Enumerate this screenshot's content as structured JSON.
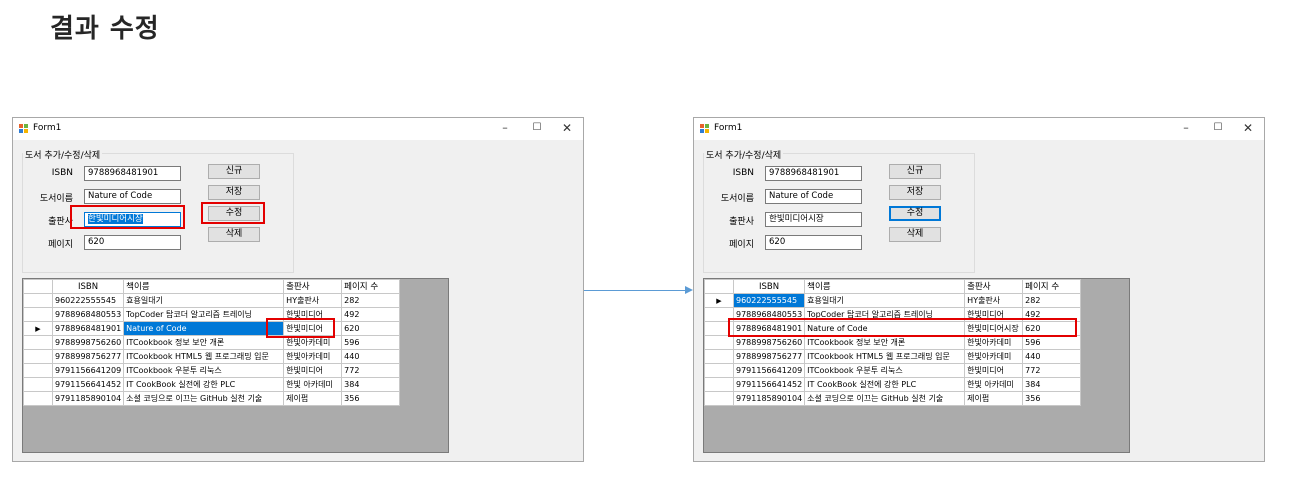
{
  "page_title": "결과 수정",
  "colors": {
    "accent": "#0078d7",
    "highlight": "#e30000",
    "arrow": "#5b9bd5"
  },
  "left_window": {
    "title": "Form1",
    "controls": {
      "minimize": "–",
      "maximize": "☐",
      "close": "✕"
    },
    "group_title": "도서 추가/수정/삭제",
    "labels": {
      "isbn": "ISBN",
      "title": "도서이름",
      "publisher": "출판사",
      "pages": "페이지"
    },
    "fields": {
      "isbn": "9788968481901",
      "title": "Nature of Code",
      "publisher": "한빛미디어시장",
      "pages": "620"
    },
    "buttons": {
      "new": "신규",
      "save": "저장",
      "edit": "수정",
      "delete": "삭제"
    },
    "grid": {
      "columns": [
        "ISBN",
        "책이름",
        "출판사",
        "페이지 수"
      ],
      "current_row_marker": "▶",
      "rows": [
        [
          "960222555545",
          "효용일대기",
          "HY출판사",
          "282"
        ],
        [
          "9788968480553",
          "TopCoder 탑코더 알고리즘 트레이닝",
          "한빛미디어",
          "492"
        ],
        [
          "9788968481901",
          "Nature of Code",
          "한빛미디어",
          "620"
        ],
        [
          "9788998756260",
          "ITCookbook 정보 보안 개론",
          "한빛아카데미",
          "596"
        ],
        [
          "9788998756277",
          "ITCookbook HTML5 웹 프로그래밍 입문",
          "한빛아카데미",
          "440"
        ],
        [
          "9791156641209",
          "ITCookbook 우분투 리눅스",
          "한빛미디어",
          "772"
        ],
        [
          "9791156641452",
          "IT CookBook 실전에 강한 PLC",
          "한빛 아카데미",
          "384"
        ],
        [
          "9791185890104",
          "소셜 코딩으로 이끄는 GitHub 실천 기술",
          "제이펍",
          "356"
        ]
      ]
    }
  },
  "right_window": {
    "title": "Form1",
    "controls": {
      "minimize": "–",
      "maximize": "☐",
      "close": "✕"
    },
    "group_title": "도서 추가/수정/삭제",
    "labels": {
      "isbn": "ISBN",
      "title": "도서이름",
      "publisher": "출판사",
      "pages": "페이지"
    },
    "fields": {
      "isbn": "9788968481901",
      "title": "Nature of Code",
      "publisher": "한빛미디어시장",
      "pages": "620"
    },
    "buttons": {
      "new": "신규",
      "save": "저장",
      "edit": "수정",
      "delete": "삭제"
    },
    "grid": {
      "columns": [
        "ISBN",
        "책이름",
        "출판사",
        "페이지 수"
      ],
      "current_row_marker": "▶",
      "rows": [
        [
          "960222555545",
          "효용일대기",
          "HY출판사",
          "282"
        ],
        [
          "9788968480553",
          "TopCoder 탑코더 알고리즘 트레이닝",
          "한빛미디어",
          "492"
        ],
        [
          "9788968481901",
          "Nature of Code",
          "한빛미디어시장",
          "620"
        ],
        [
          "9788998756260",
          "ITCookbook 정보 보안 개론",
          "한빛아카데미",
          "596"
        ],
        [
          "9788998756277",
          "ITCookbook HTML5 웹 프로그래밍 입문",
          "한빛아카데미",
          "440"
        ],
        [
          "9791156641209",
          "ITCookbook 우분투 리눅스",
          "한빛미디어",
          "772"
        ],
        [
          "9791156641452",
          "IT CookBook 실전에 강한 PLC",
          "한빛 아카데미",
          "384"
        ],
        [
          "9791185890104",
          "소셜 코딩으로 이끄는 GitHub 실천 기술",
          "제이펍",
          "356"
        ]
      ]
    }
  }
}
